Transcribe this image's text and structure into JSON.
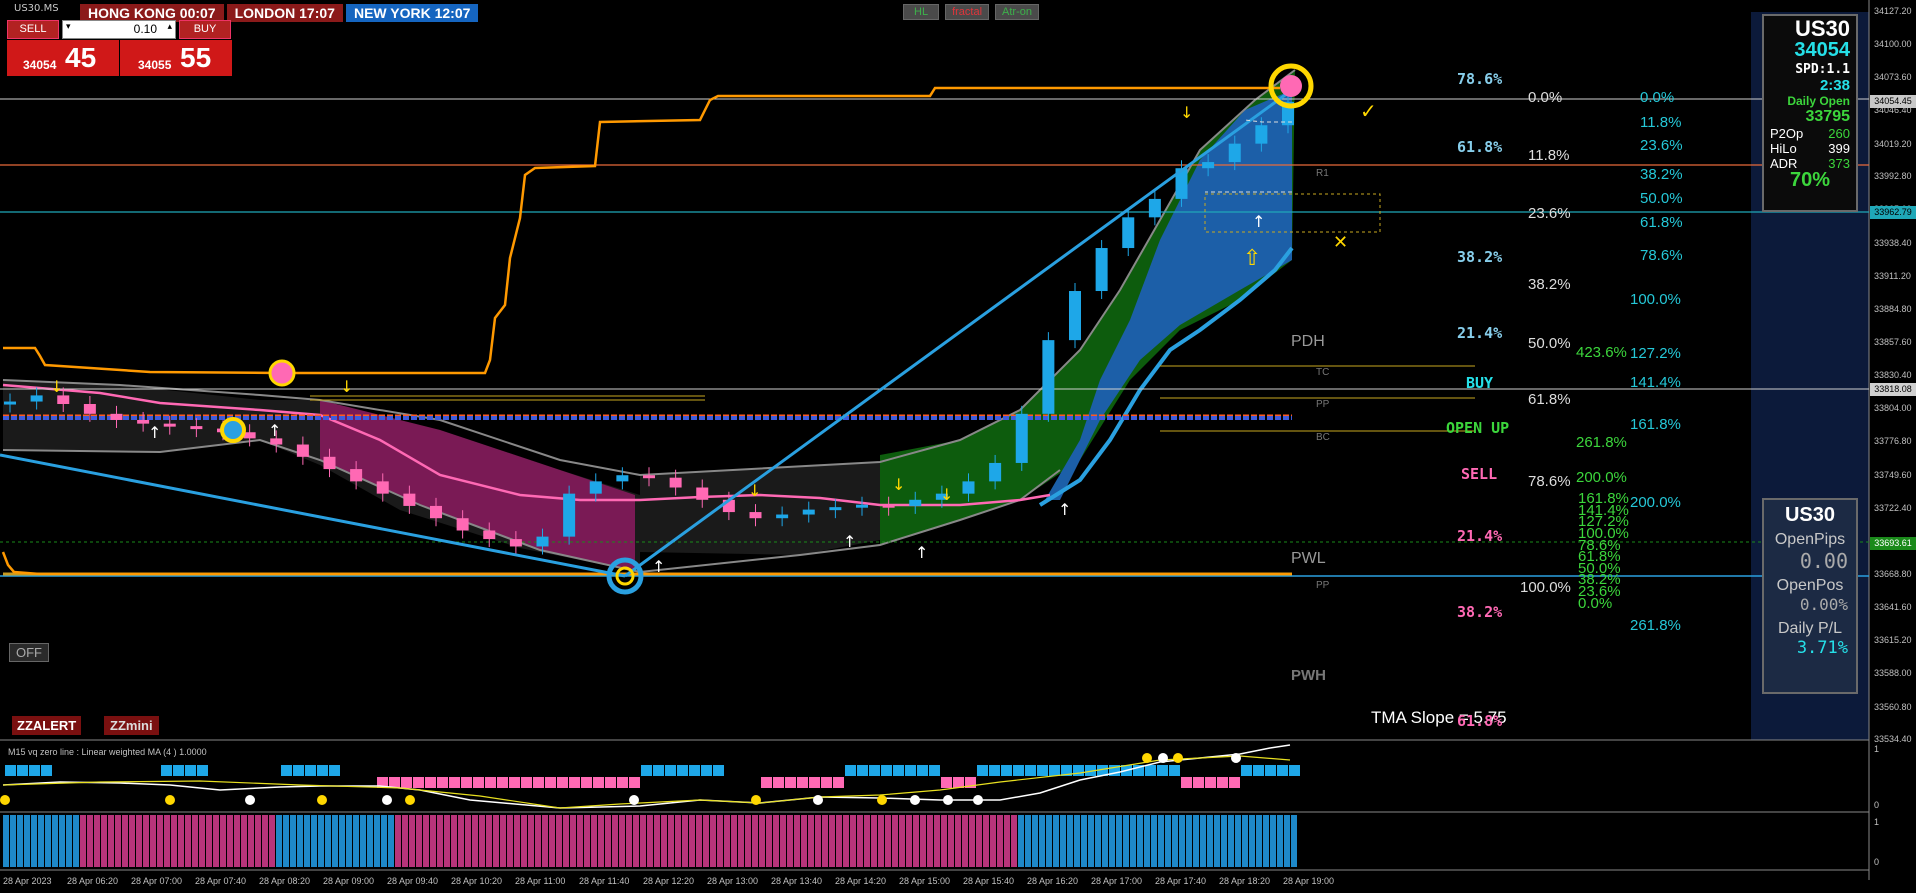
{
  "symbol_title": "US30.MS",
  "clocks": [
    {
      "label": "HONG KONG 00:07",
      "bg": "#8b1a1a"
    },
    {
      "label": "LONDON  17:07",
      "bg": "#8b1a1a"
    },
    {
      "label": "NEW YORK  12:07",
      "bg": "#1565c0"
    }
  ],
  "toolbar_buttons": [
    {
      "label": "HL",
      "color": "#3db04b"
    },
    {
      "label": "fractal",
      "color": "#e0353b"
    },
    {
      "label": "Atr-on",
      "color": "#3db04b"
    }
  ],
  "trade_panel": {
    "sell_label": "SELL",
    "buy_label": "BUY",
    "volume": "0.10",
    "sell_price_small": "34054",
    "sell_price_big": "45",
    "buy_price_small": "34055",
    "buy_price_big": "55"
  },
  "info_box": {
    "symbol": "US30",
    "price": "34054",
    "spread": "SPD:1.1",
    "timer": "2:38",
    "daily_open_label": "Daily Open",
    "daily_open": "33795",
    "rows": [
      {
        "label": "P2Op",
        "value": "260"
      },
      {
        "label": "HiLo",
        "value": "399"
      },
      {
        "label": "ADR",
        "value": "373"
      }
    ],
    "percent": "70%"
  },
  "account_box": {
    "symbol": "US30",
    "open_pips_label": "OpenPips",
    "open_pips": "0.00",
    "open_pos_label": "OpenPos",
    "open_pos": "0.00%",
    "daily_pl_label": "Daily P/L",
    "daily_pl": "3.71%"
  },
  "off_button": "OFF",
  "zzalert_label": "ZZALERT",
  "zzmini_label": "ZZmini",
  "tma_slope": "TMA Slope = 5.75",
  "signal_labels": {
    "buy": "BUY",
    "open_up": "OPEN UP",
    "sell": "SELL"
  },
  "pivot_labels": [
    "PDH",
    "PWL",
    "PWH",
    "R1",
    "TC",
    "PP",
    "BC",
    "PP"
  ],
  "fib_col1": [
    {
      "text": "78.6%",
      "color": "#87ceeb"
    },
    {
      "text": "61.8%",
      "color": "#87ceeb"
    },
    {
      "text": "38.2%",
      "color": "#87ceeb"
    },
    {
      "text": "21.4%",
      "color": "#87ceeb"
    },
    {
      "text": "21.4%",
      "color": "#ff69b4"
    },
    {
      "text": "38.2%",
      "color": "#ff69b4"
    },
    {
      "text": "61.8%",
      "color": "#ff69b4"
    }
  ],
  "fib_col2": [
    "0.0%",
    "11.8%",
    "23.6%",
    "38.2%",
    "50.0%",
    "61.8%",
    "78.6%",
    "100.0%"
  ],
  "fib_col3": [
    "0.0%",
    "11.8%",
    "23.6%",
    "38.2%",
    "50.0%",
    "61.8%",
    "78.6%",
    "100.0%",
    "127.2%",
    "141.4%",
    "161.8%",
    "200.0%",
    "261.8%"
  ],
  "fib_col4": [
    "423.6%",
    "261.8%",
    "200.0%",
    "161.8%",
    "141.4%",
    "127.2%",
    "100.0%",
    "78.6%",
    "61.8%",
    "50.0%",
    "38.2%",
    "23.6%",
    "0.0%"
  ],
  "price_axis": [
    "34127.20",
    "34100.00",
    "34073.60",
    "34046.40",
    "34019.20",
    "33992.80",
    "33965.60",
    "33938.40",
    "33911.20",
    "33884.80",
    "33857.60",
    "33830.40",
    "33804.00",
    "33776.80",
    "33749.60",
    "33722.40",
    "33696.00",
    "33668.80",
    "33641.60",
    "33615.20",
    "33588.00",
    "33560.80",
    "33534.40"
  ],
  "price_tags": [
    {
      "text": "34054.45",
      "bg": "#c8c8c8",
      "color": "#000"
    },
    {
      "text": "33962.79",
      "bg": "#1fa8b8",
      "color": "#000"
    },
    {
      "text": "33818.08",
      "bg": "#d0d0d0",
      "color": "#000"
    },
    {
      "text": "33693.61",
      "bg": "#1a8a1a",
      "color": "#fff"
    }
  ],
  "indicator_label": "M15  vq zero line :   Linear weighted MA (4 ) 1.0000",
  "sub_axis1": [
    "1",
    "0"
  ],
  "sub_axis2": [
    "1",
    "0"
  ],
  "time_axis": [
    "28 Apr 2023",
    "28 Apr 06:20",
    "28 Apr 07:00",
    "28 Apr 07:40",
    "28 Apr 08:20",
    "28 Apr 09:00",
    "28 Apr 09:40",
    "28 Apr 10:20",
    "28 Apr 11:00",
    "28 Apr 11:40",
    "28 Apr 12:20",
    "28 Apr 13:00",
    "28 Apr 13:40",
    "28 Apr 14:20",
    "28 Apr 15:00",
    "28 Apr 15:40",
    "28 Apr 16:20",
    "28 Apr 17:00",
    "28 Apr 17:40",
    "28 Apr 18:20",
    "28 Apr 19:00"
  ],
  "colors": {
    "bull": "#1ea7e8",
    "bear": "#ff69b4",
    "green_band": "#0d5c0d",
    "blue_band": "#1c5fa8",
    "pink_band": "#7a1a55",
    "orange": "#ff9900"
  },
  "chart_data": {
    "type": "line",
    "title": "US30.MS",
    "xlabel": "",
    "ylabel": "",
    "ylim": [
      33534.4,
      34127.2
    ],
    "series": [
      {
        "values": [
          33810,
          33815,
          33808,
          33800,
          33795,
          33792,
          33790,
          33788,
          33785,
          33780,
          33775,
          33765,
          33755,
          33745,
          33735,
          33725,
          33715,
          33705,
          33698,
          33692,
          33700,
          33735,
          33745,
          33750,
          33748,
          33740,
          33730,
          33720,
          33715,
          33718,
          33722,
          33724,
          33726,
          33725,
          33730,
          33735,
          33745,
          33760,
          33800,
          33860,
          33900,
          33935,
          33960,
          33975,
          34000,
          34005,
          34020,
          34035,
          34054
        ]
      }
    ]
  }
}
